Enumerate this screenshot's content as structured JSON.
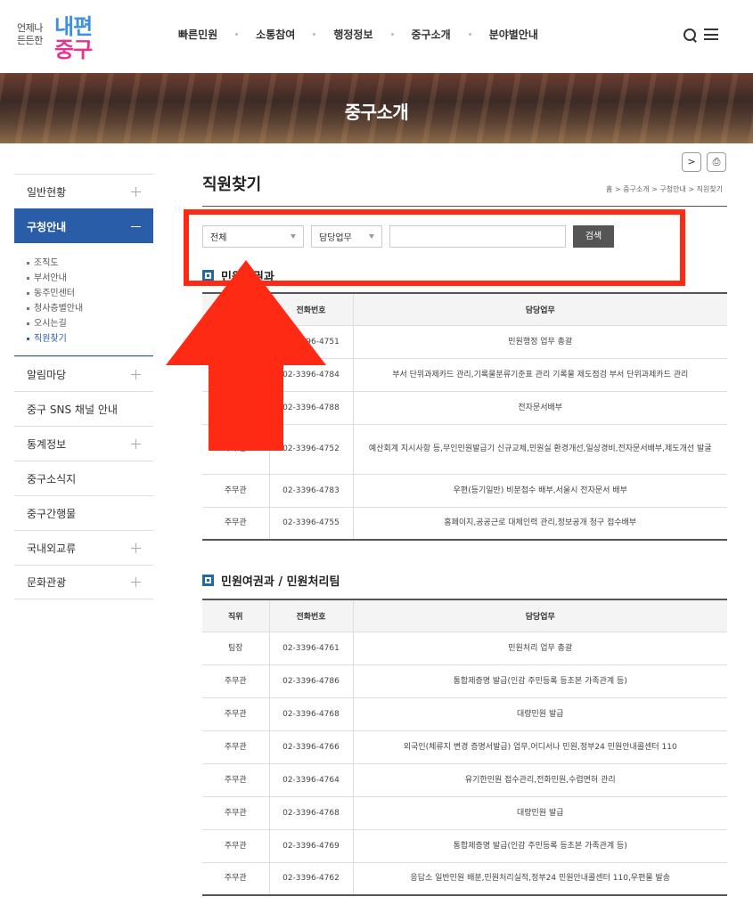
{
  "header": {
    "logo": {
      "small_line1": "언제나",
      "small_line2": "든든한",
      "big_line1": "내편",
      "big_line2": "중구"
    },
    "nav": [
      "빠른민원",
      "소통참여",
      "행정정보",
      "중구소개",
      "분야별안내"
    ],
    "icons": [
      "search-icon",
      "menu-icon"
    ]
  },
  "banner": {
    "title": "중구소개"
  },
  "sidebar": {
    "items_top": [
      {
        "label": "일반현황",
        "state": "collapsed"
      }
    ],
    "active": {
      "label": "구청안내"
    },
    "subitems": [
      "조직도",
      "부서안내",
      "동주민센터",
      "청사층별안내",
      "오시는길",
      "직원찾기"
    ],
    "current_sub": "직원찾기",
    "items_bottom": [
      {
        "label": "알림마당",
        "expandable": true
      },
      {
        "label": "중구 SNS 채널 안내",
        "expandable": false
      },
      {
        "label": "통계정보",
        "expandable": true
      },
      {
        "label": "중구소식지",
        "expandable": false
      },
      {
        "label": "중구간행물",
        "expandable": false
      },
      {
        "label": "국내외교류",
        "expandable": true
      },
      {
        "label": "문화관광",
        "expandable": true
      }
    ]
  },
  "content": {
    "util": {
      "share": ">",
      "print": "⎙"
    },
    "title": "직원찾기",
    "breadcrumb": "홈 > 중구소개 > 구청안내 > 직원찾기",
    "search": {
      "select1": "전체",
      "select2": "담당업무",
      "input_value": "",
      "button": "검색"
    },
    "section1": {
      "title": "민원여권과",
      "headers": [
        "직위",
        "전화번호",
        "담당업무"
      ],
      "rows": [
        {
          "pos": "",
          "phone": "02-3396-4751",
          "duty": "민원행정 업무 총괄"
        },
        {
          "pos": "",
          "phone": "02-3396-4784",
          "duty": "부서 단위과제카드 관리,기록물분류기준표 관리 기록물 제도점검 부서 단위과제카드 관리"
        },
        {
          "pos": "",
          "phone": "02-3396-4788",
          "duty": "전자문서배부"
        },
        {
          "pos": "주무관",
          "phone": "02-3396-4752",
          "duty": "예산회계 지시사항 등,무인민원발급기 신규교체,민원실 환경개선,일상경비,전자문서배부,제도개선 발굴"
        },
        {
          "pos": "주무관",
          "phone": "02-3396-4783",
          "duty": "우편(등기일반) 비분접수 배부,서울시 전자문서 배부"
        },
        {
          "pos": "주무관",
          "phone": "02-3396-4755",
          "duty": "홈페이지,공공근로 대체인력 관리,정보공개 청구 접수배부"
        }
      ]
    },
    "section2": {
      "title": "민원여권과 / 민원처리팀",
      "headers": [
        "직위",
        "전화번호",
        "담당업무"
      ],
      "rows": [
        {
          "pos": "팀장",
          "phone": "02-3396-4761",
          "duty": "민원처리 업무 총괄"
        },
        {
          "pos": "주무관",
          "phone": "02-3396-4786",
          "duty": "통합제증명 발급(인감 주민등록 등초본 가족관계 등)"
        },
        {
          "pos": "주무관",
          "phone": "02-3396-4768",
          "duty": "대량민원 발급"
        },
        {
          "pos": "주무관",
          "phone": "02-3396-4766",
          "duty": "외국인(체류지 변경 증명서발급) 업무,어디서나 민원,정부24 민원안내콜센터 110"
        },
        {
          "pos": "주무관",
          "phone": "02-3396-4764",
          "duty": "유기한민원 접수관리,전화민원,수렵면허 관리"
        },
        {
          "pos": "주무관",
          "phone": "02-3396-4768",
          "duty": "대량민원 발급"
        },
        {
          "pos": "주무관",
          "phone": "02-3396-4769",
          "duty": "통합제증명 발급(인감 주민등록 등초본 가족관계 등)"
        },
        {
          "pos": "주무관",
          "phone": "02-3396-4762",
          "duty": "응답소 일반민원 배분,민원처리실적,정부24 민원안내콜센터 110,우편물 발송"
        }
      ]
    }
  },
  "colors": {
    "accent": "#2a5da8",
    "highlight": "#ff2a14",
    "logo_blue": "#3d8fe0",
    "logo_pink": "#e6338c"
  }
}
